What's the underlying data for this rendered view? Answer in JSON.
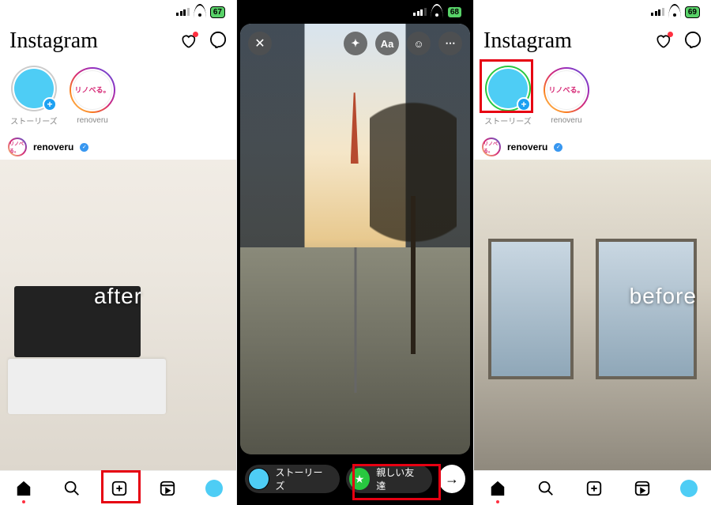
{
  "statusbar": {
    "battery1": "67",
    "battery2": "68",
    "battery3": "69"
  },
  "app": {
    "logo": "Instagram"
  },
  "header": {
    "like_icon": "heart",
    "dm_icon": "messenger"
  },
  "stories": {
    "self_label": "ストーリーズ",
    "other_label": "renoveru",
    "other_avatar_text": "リノべる。"
  },
  "post": {
    "username": "renoveru",
    "overlay_after": "after",
    "overlay_before": "before"
  },
  "editor": {
    "close": "✕",
    "tool_effects": "✦",
    "tool_text": "Aa",
    "tool_sticker": "☺",
    "tool_more": "⋯",
    "pill_story": "ストーリーズ",
    "pill_close_friends": "親しい友達",
    "send": "→",
    "star": "★"
  },
  "nav": {
    "home": "home",
    "search": "search",
    "create": "create",
    "reels": "reels",
    "profile": "profile"
  }
}
